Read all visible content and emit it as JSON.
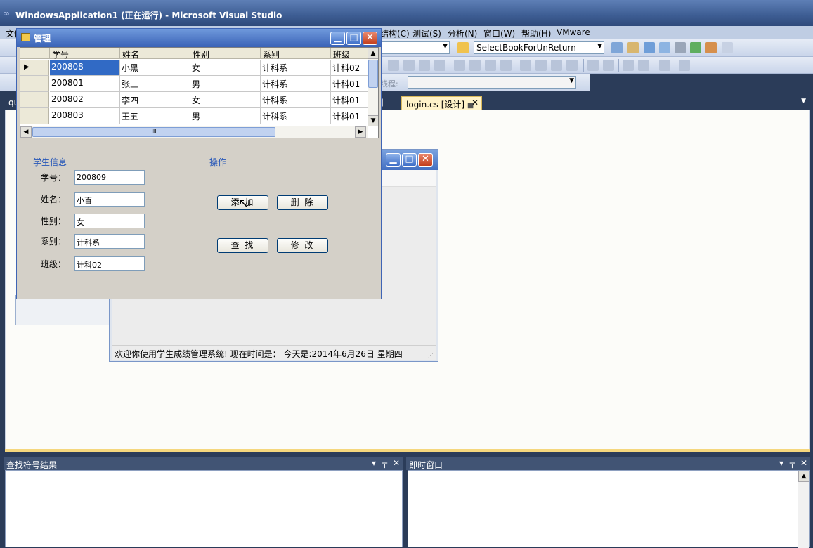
{
  "vs": {
    "title": "WindowsApplication1 (正在运行) - Microsoft Visual Studio",
    "menu": [
      "文件",
      "结构(C)",
      "测试(S)",
      "分析(N)",
      "窗口(W)",
      "帮助(H)",
      "VMware"
    ],
    "toolbar_combo": "SelectBookForUnReturn",
    "thread_label": "线程:",
    "tabs": [
      "qu",
      "login.cs [设计]"
    ],
    "partial_tab_text": "]"
  },
  "panels": {
    "left_title": "查找符号结果",
    "right_title": "即时窗口"
  },
  "bg_form": {
    "status_text": "欢迎你使用学生成绩管理系统!   现在时间是：  今天是:2014年6月26日 星期四"
  },
  "mgmt": {
    "title": "管理",
    "grid": {
      "columns": [
        "学号",
        "姓名",
        "性别",
        "系别",
        "班级"
      ],
      "rows": [
        [
          "200808",
          "小黑",
          "女",
          "计科系",
          "计科02"
        ],
        [
          "200801",
          "张三",
          "男",
          "计科系",
          "计科01"
        ],
        [
          "200802",
          "李四",
          "女",
          "计科系",
          "计科01"
        ],
        [
          "200803",
          "王五",
          "男",
          "计科系",
          "计科01"
        ]
      ],
      "scroll_thumb_label": "III"
    },
    "info_group": "学生信息",
    "op_group": "操作",
    "fields": {
      "id_label": "学号：",
      "id_value": "200809",
      "name_label": "姓名：",
      "name_value": "小百",
      "sex_label": "性别：",
      "sex_value": "女",
      "dept_label": "系别：",
      "dept_value": "计科系",
      "class_label": "班级：",
      "class_value": "计科02"
    },
    "buttons": {
      "add": "添 加",
      "delete": "删 除",
      "search": "查 找",
      "edit": "修 改"
    }
  }
}
